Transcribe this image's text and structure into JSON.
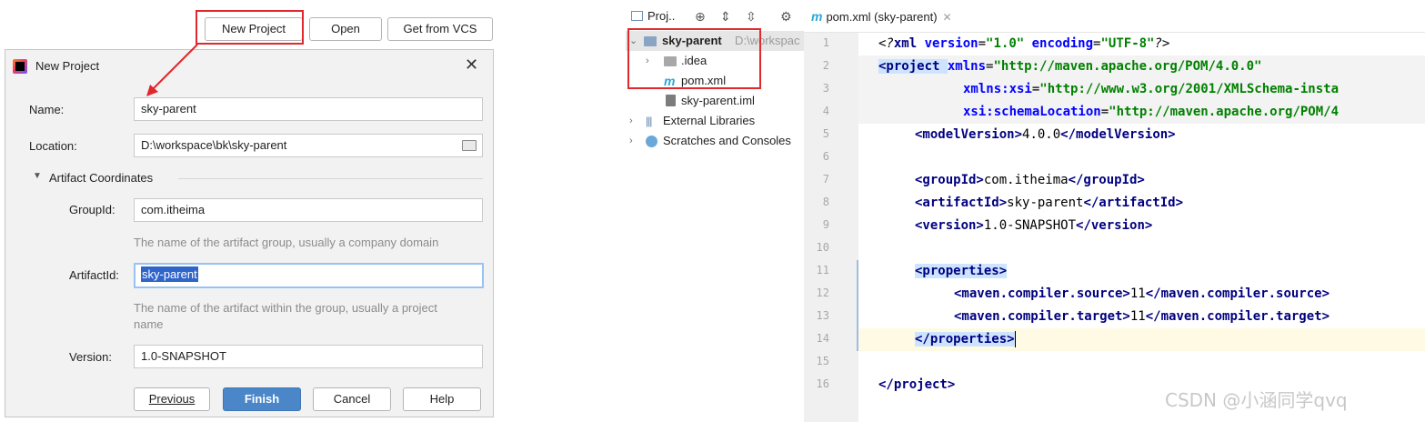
{
  "top_buttons": {
    "new_project": "New Project",
    "open": "Open",
    "get_from_vcs": "Get from VCS"
  },
  "dialog": {
    "title": "New Project",
    "close_glyph": "✕",
    "name_label": "Name:",
    "name_value": "sky-parent",
    "location_label": "Location:",
    "location_value": "D:\\workspace\\bk\\sky-parent",
    "artifact_section": "Artifact Coordinates",
    "groupid_label": "GroupId:",
    "groupid_value": "com.itheima",
    "groupid_hint": "The name of the artifact group, usually a company domain",
    "artifactid_label": "ArtifactId:",
    "artifactid_value": "sky-parent",
    "artifactid_hint_line1": "The name of the artifact within the group, usually a project",
    "artifactid_hint_line2": "name",
    "version_label": "Version:",
    "version_value": "1.0-SNAPSHOT",
    "buttons": {
      "previous": "Previous",
      "finish": "Finish",
      "cancel": "Cancel",
      "help": "Help"
    }
  },
  "ide": {
    "project_tool_label": "Proj..",
    "tree": {
      "root_name": "sky-parent",
      "root_path": "D:\\workspac",
      "idea": ".idea",
      "pom": "pom.xml",
      "iml": "sky-parent.iml",
      "external_libraries": "External Libraries",
      "scratches": "Scratches and Consoles"
    },
    "tab_label": "pom.xml (sky-parent)",
    "line_numbers": [
      "1",
      "2",
      "3",
      "4",
      "5",
      "6",
      "7",
      "8",
      "9",
      "10",
      "11",
      "12",
      "13",
      "14",
      "15",
      "16"
    ],
    "code": {
      "l1": [
        "<?",
        "xml ",
        "version",
        "=",
        "\"1.0\" ",
        "encoding",
        "=",
        "\"UTF-8\"",
        "?>"
      ],
      "l2_tag": "<project ",
      "l2_attr": "xmlns",
      "l2_val": "\"http://maven.apache.org/POM/4.0.0\"",
      "l3_attr": "xmlns:xsi",
      "l3_val": "\"http://www.w3.org/2001/XMLSchema-insta",
      "l4_attr": "xsi:schemaLocation",
      "l4_val": "\"http://maven.apache.org/POM/4",
      "model_open": "<modelVersion>",
      "model_val": "4.0.0",
      "model_close": "</modelVersion>",
      "group_open": "<groupId>",
      "group_val": "com.itheima",
      "group_close": "</groupId>",
      "artifact_open": "<artifactId>",
      "artifact_val": "sky-parent",
      "artifact_close": "</artifactId>",
      "version_open": "<version>",
      "version_val": "1.0-SNAPSHOT",
      "version_close": "</version>",
      "props_open": "<properties>",
      "src_open": "<maven.compiler.source>",
      "src_val": "11",
      "src_close": "</maven.compiler.source>",
      "tgt_open": "<maven.compiler.target>",
      "tgt_val": "11",
      "tgt_close": "</maven.compiler.target>",
      "props_close": "</properties>",
      "project_close": "</project>"
    }
  },
  "watermark": "CSDN @小涵同学qvq",
  "colors": {
    "annotation_red": "#e0282e",
    "primary_button": "#4a86c8",
    "selection": "#2f65ca",
    "xml_tag": "#000080",
    "xml_attr": "#0000ff",
    "xml_value": "#008000"
  }
}
